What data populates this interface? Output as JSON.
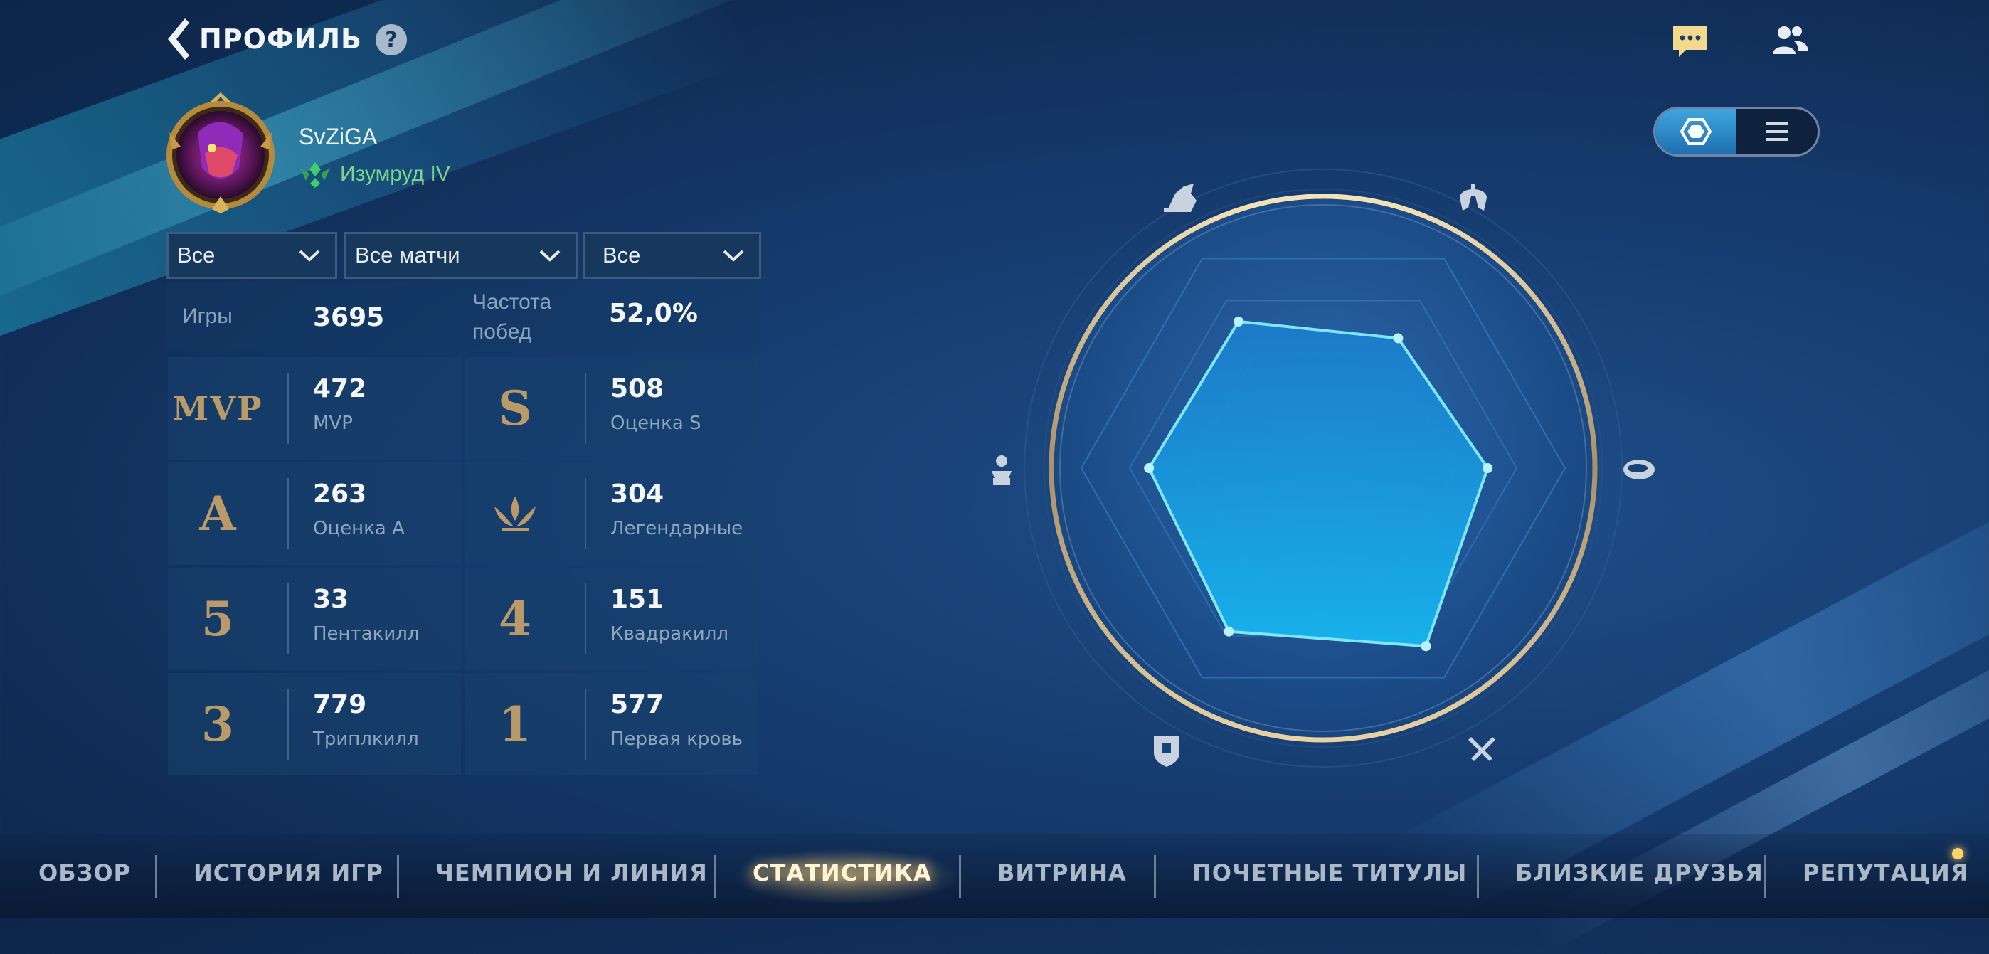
{
  "header": {
    "title": "ПРОФИЛЬ",
    "help": "?"
  },
  "player": {
    "name": "SvZiGA",
    "rank": "Изумруд IV"
  },
  "filters": [
    {
      "label": "Все"
    },
    {
      "label": "Все матчи"
    },
    {
      "label": "Все"
    }
  ],
  "summary": {
    "games_label": "Игры",
    "games_value": "3695",
    "winrate_label_1": "Частота",
    "winrate_label_2": "побед",
    "winrate_value": "52,0%"
  },
  "stats": [
    {
      "badge": "MVP",
      "value": "472",
      "label": "MVP"
    },
    {
      "badge": "S",
      "value": "508",
      "label": "Оценка S"
    },
    {
      "badge": "A",
      "value": "263",
      "label": "Оценка A"
    },
    {
      "badge": "legendary-icon",
      "value": "304",
      "label": "Легендарные"
    },
    {
      "badge": "5",
      "value": "33",
      "label": "Пентакилл"
    },
    {
      "badge": "4",
      "value": "151",
      "label": "Квадракилл"
    },
    {
      "badge": "3",
      "value": "779",
      "label": "Триплкилл"
    },
    {
      "badge": "1",
      "value": "577",
      "label": "Первая кровь"
    }
  ],
  "radar": {
    "axes": [
      "assassin-icon",
      "fighter-icon",
      "mage-icon",
      "support-icon",
      "tank-icon",
      "marksman-icon"
    ],
    "values": [
      0.7,
      0.62,
      0.68,
      0.85,
      0.78,
      0.72
    ]
  },
  "nav": {
    "items": [
      "ОБЗОР",
      "ИСТОРИЯ ИГР",
      "ЧЕМПИОН И ЛИНИЯ",
      "СТАТИСТИКА",
      "ВИТРИНА",
      "ПОЧЕТНЫЕ ТИТУЛЫ",
      "БЛИЗКИЕ ДРУЗЬЯ",
      "РЕПУТАЦИЯ"
    ],
    "active_index": 3
  },
  "colors": {
    "accent": "#3ec8ff",
    "gold": "#b99a68",
    "rank": "#7fd38f"
  }
}
